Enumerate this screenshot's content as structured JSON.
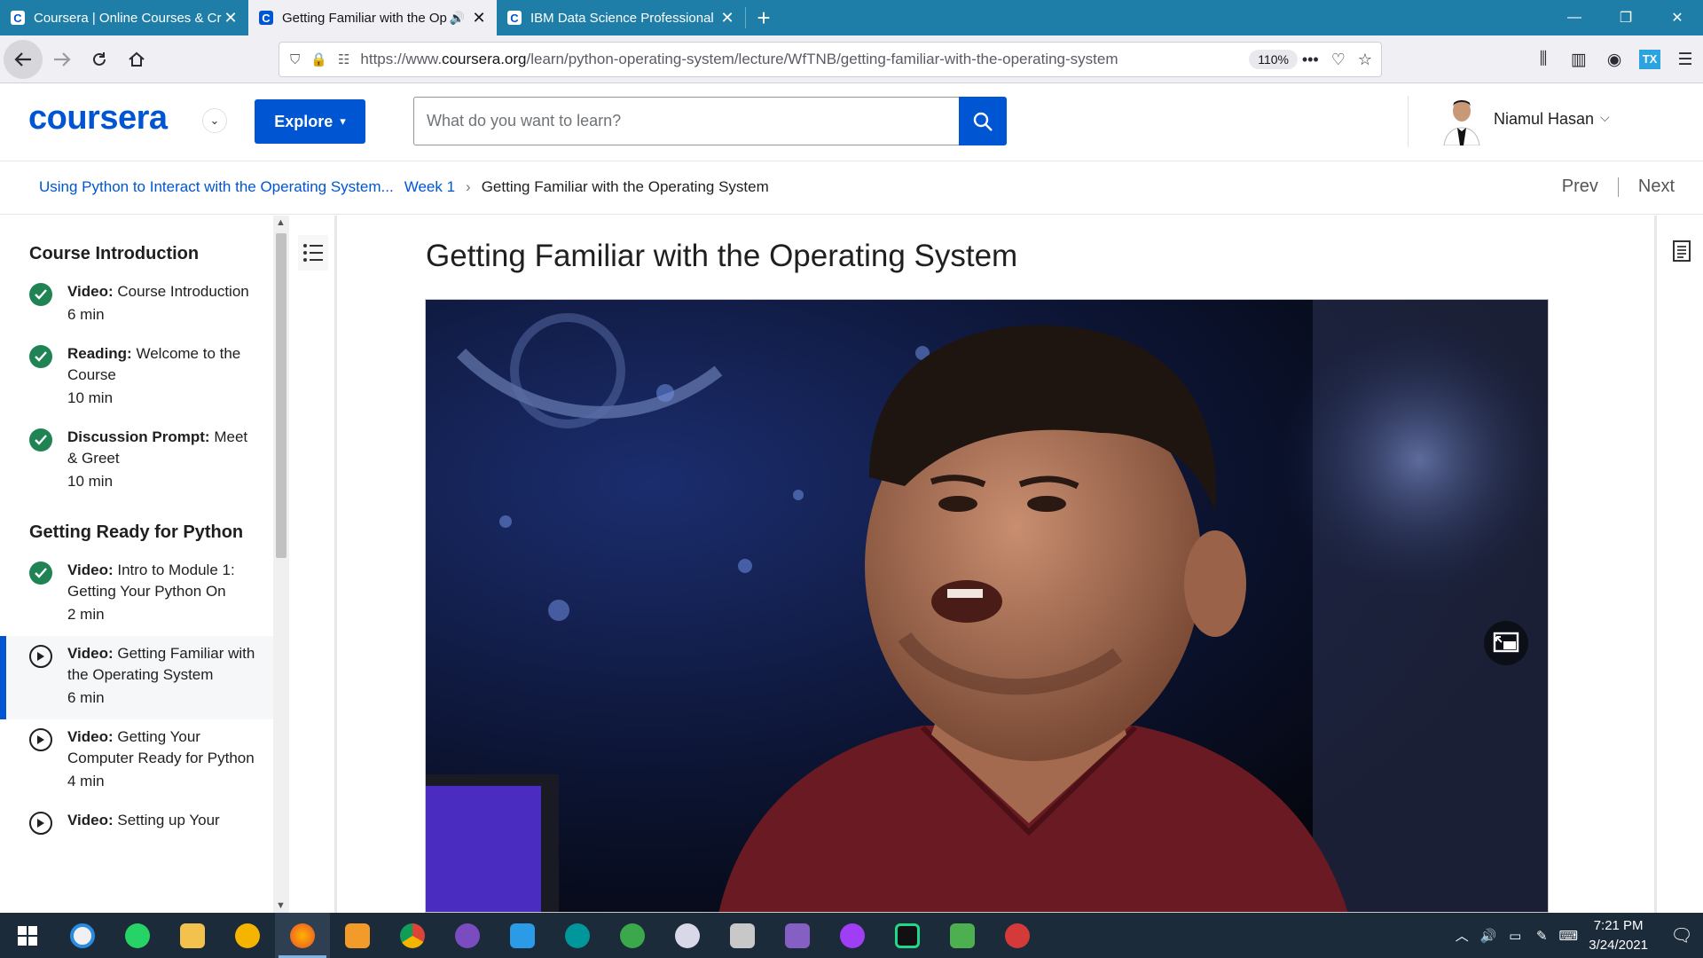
{
  "browser": {
    "tabs": [
      {
        "title": "Coursera | Online Courses & Cr",
        "active": false,
        "audio": false
      },
      {
        "title": "Getting Familiar with the Op",
        "active": true,
        "audio": true
      },
      {
        "title": "IBM Data Science Professional",
        "active": false,
        "audio": false
      }
    ],
    "url_prefix": "https://www.",
    "url_host": "coursera.org",
    "url_path": "/learn/python-operating-system/lecture/WfTNB/getting-familiar-with-the-operating-system",
    "zoom": "110%"
  },
  "header": {
    "logo": "coursera",
    "explore_label": "Explore",
    "search_placeholder": "What do you want to learn?",
    "user_name": "Niamul Hasan"
  },
  "breadcrumb": {
    "course": "Using Python to Interact with the Operating System...",
    "week": "Week 1",
    "current": "Getting Familiar with the Operating System",
    "prev": "Prev",
    "next": "Next"
  },
  "sidebar": {
    "sections": [
      {
        "title": "Course Introduction",
        "items": [
          {
            "kind": "Video:",
            "title": "Course Introduction",
            "duration": "6 min",
            "status": "done"
          },
          {
            "kind": "Reading:",
            "title": "Welcome to the Course",
            "duration": "10 min",
            "status": "done"
          },
          {
            "kind": "Discussion Prompt:",
            "title": "Meet & Greet",
            "duration": "10 min",
            "status": "done"
          }
        ]
      },
      {
        "title": "Getting Ready for Python",
        "items": [
          {
            "kind": "Video:",
            "title": "Intro to Module 1: Getting Your Python On",
            "duration": "2 min",
            "status": "done"
          },
          {
            "kind": "Video:",
            "title": "Getting Familiar with the Operating System",
            "duration": "6 min",
            "status": "active"
          },
          {
            "kind": "Video:",
            "title": "Getting Your Computer Ready for Python",
            "duration": "4 min",
            "status": "play"
          },
          {
            "kind": "Video:",
            "title": "Setting up Your",
            "duration": "",
            "status": "play"
          }
        ]
      }
    ]
  },
  "main": {
    "lecture_title": "Getting Familiar with the Operating System"
  },
  "taskbar": {
    "time": "7:21 PM",
    "date": "3/24/2021"
  },
  "colors": {
    "brand": "#0056d2",
    "tabbar": "#1e7ea7",
    "done": "#1f8354",
    "taskbar": "#1c2b3a"
  }
}
